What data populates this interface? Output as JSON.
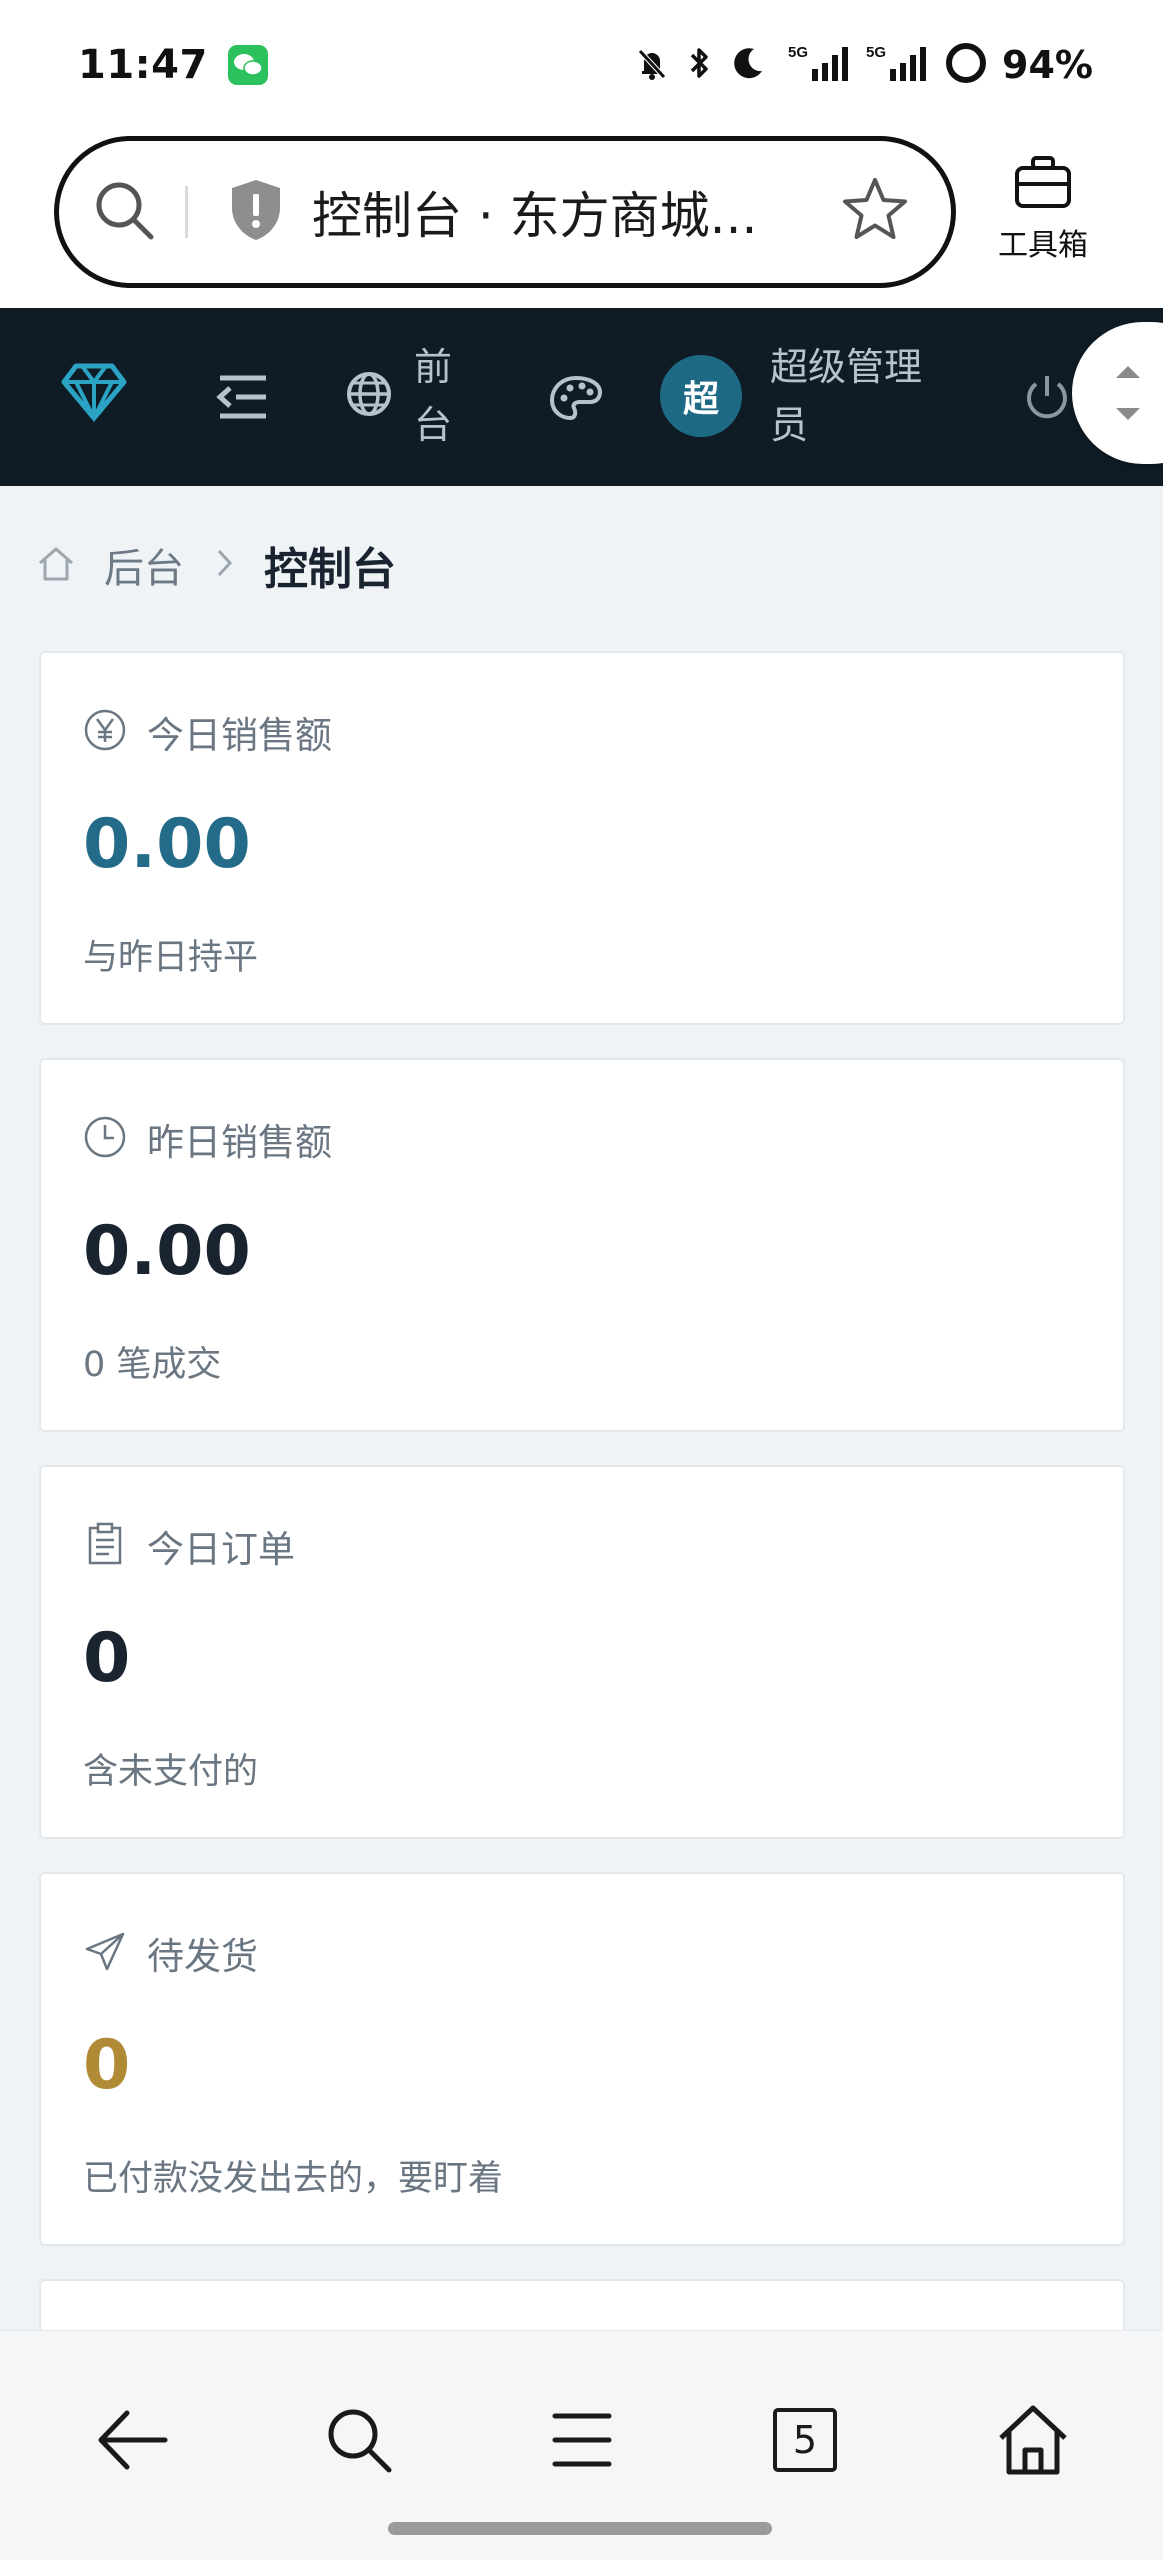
{
  "status_bar": {
    "time": "11:47",
    "battery": "94%",
    "icons": [
      "wechat-icon",
      "mute-bell-icon",
      "bluetooth-icon",
      "moon-icon",
      "signal-5g-icon",
      "signal-5g-icon",
      "battery-ring-icon"
    ]
  },
  "browser": {
    "url_title": "控制台 · 东方商城...",
    "toolbox_label": "工具箱"
  },
  "admin_header": {
    "frontend_label": "前台",
    "avatar_text": "超",
    "user_name": "超级管理员",
    "accent_color": "#1e6a85"
  },
  "breadcrumb": {
    "parent": "后台",
    "current": "控制台"
  },
  "cards": [
    {
      "title": "今日销售额",
      "value": "0.00",
      "note": "与昨日持平",
      "icon": "yen-icon",
      "value_color": "#236b88"
    },
    {
      "title": "昨日销售额",
      "value": "0.00",
      "note": "0 笔成交",
      "icon": "clock-icon",
      "value_color": "#1a2430"
    },
    {
      "title": "今日订单",
      "value": "0",
      "note": "含未支付的",
      "icon": "clipboard-icon",
      "value_color": "#1a2430"
    },
    {
      "title": "待发货",
      "value": "0",
      "note": "已付款没发出去的，要盯着",
      "icon": "send-icon",
      "value_color": "#b08a35"
    }
  ],
  "bottom_nav": {
    "tab_count": "5"
  }
}
